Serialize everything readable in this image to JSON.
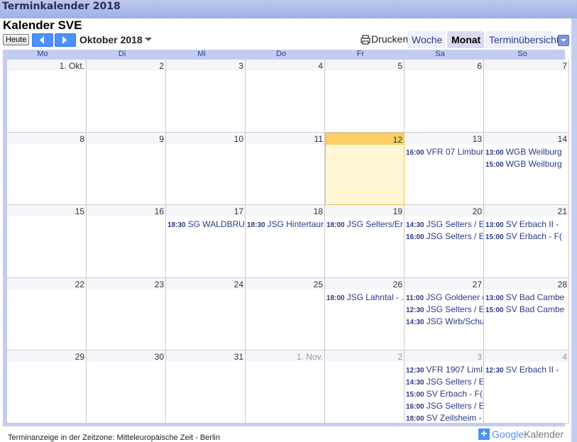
{
  "window": {
    "title": "Terminkalender 2018"
  },
  "calendar": {
    "title": "Kalender SVE"
  },
  "toolbar": {
    "today": "Heute",
    "month_label": "Oktober 2018",
    "print": "Drucken"
  },
  "tabs": {
    "week": "Woche",
    "month": "Monat",
    "agenda": "Terminübersicht"
  },
  "weekdays": [
    "Mo",
    "Di",
    "Mi",
    "Do",
    "Fr",
    "Sa",
    "So"
  ],
  "weeks": [
    [
      {
        "d": "1. Okt."
      },
      {
        "d": "2"
      },
      {
        "d": "3"
      },
      {
        "d": "4"
      },
      {
        "d": "5"
      },
      {
        "d": "6"
      },
      {
        "d": "7"
      }
    ],
    [
      {
        "d": "8"
      },
      {
        "d": "9"
      },
      {
        "d": "10"
      },
      {
        "d": "11"
      },
      {
        "d": "12",
        "today": true
      },
      {
        "d": "13"
      },
      {
        "d": "14"
      }
    ],
    [
      {
        "d": "15"
      },
      {
        "d": "16"
      },
      {
        "d": "17"
      },
      {
        "d": "18"
      },
      {
        "d": "19"
      },
      {
        "d": "20"
      },
      {
        "d": "21"
      }
    ],
    [
      {
        "d": "22"
      },
      {
        "d": "23"
      },
      {
        "d": "24"
      },
      {
        "d": "25"
      },
      {
        "d": "26"
      },
      {
        "d": "27"
      },
      {
        "d": "28"
      }
    ],
    [
      {
        "d": "29"
      },
      {
        "d": "30"
      },
      {
        "d": "31"
      },
      {
        "d": "1. Nov.",
        "other": true
      },
      {
        "d": "2",
        "other": true
      },
      {
        "d": "3",
        "other": true
      },
      {
        "d": "4",
        "other": true
      }
    ]
  ],
  "events": [
    {
      "week": 1,
      "day": 5,
      "items": [
        {
          "time": "16:00",
          "title": "VFR 07 Limbur"
        }
      ]
    },
    {
      "week": 1,
      "day": 6,
      "items": [
        {
          "time": "13:00",
          "title": "WGB Weilburg"
        },
        {
          "time": "15:00",
          "title": "WGB Weilburg"
        }
      ]
    },
    {
      "week": 2,
      "day": 2,
      "items": [
        {
          "time": "18:30",
          "title": "SG WALDBRUN"
        }
      ]
    },
    {
      "week": 2,
      "day": 3,
      "items": [
        {
          "time": "18:30",
          "title": "JSG Hintertaur"
        }
      ]
    },
    {
      "week": 2,
      "day": 4,
      "items": [
        {
          "time": "18:00",
          "title": "JSG Selters/Er"
        }
      ]
    },
    {
      "week": 2,
      "day": 5,
      "items": [
        {
          "time": "14:30",
          "title": "JSG Selters / E"
        },
        {
          "time": "16:00",
          "title": "JSG Selters / E"
        }
      ]
    },
    {
      "week": 2,
      "day": 6,
      "items": [
        {
          "time": "13:00",
          "title": "SV Erbach II -"
        },
        {
          "time": "15:00",
          "title": "SV Erbach - F("
        }
      ]
    },
    {
      "week": 3,
      "day": 4,
      "items": [
        {
          "time": "18:00",
          "title": "JSG Lahntal - ."
        }
      ]
    },
    {
      "week": 3,
      "day": 5,
      "items": [
        {
          "time": "11:00",
          "title": "JSG Goldener ("
        },
        {
          "time": "12:30",
          "title": "JSG Selters / E"
        },
        {
          "time": "14:30",
          "title": "JSG Wirb/Schu"
        }
      ]
    },
    {
      "week": 3,
      "day": 6,
      "items": [
        {
          "time": "13:00",
          "title": "SV Bad Cambe"
        },
        {
          "time": "15:00",
          "title": "SV Bad Cambe"
        }
      ]
    },
    {
      "week": 4,
      "day": 5,
      "items": [
        {
          "time": "12:30",
          "title": "VFR 1907 Liml"
        },
        {
          "time": "14:30",
          "title": "JSG Selters / E"
        },
        {
          "time": "15:00",
          "title": "SV Erbach - F("
        },
        {
          "time": "16:00",
          "title": "JSG Selters / E"
        },
        {
          "time": "18:00",
          "title": "SV Zeilsheim -"
        }
      ]
    },
    {
      "week": 4,
      "day": 6,
      "items": [
        {
          "time": "12:30",
          "title": "SV Erbach II -"
        }
      ]
    }
  ],
  "footer": {
    "timezone": "Terminanzeige in der Zeitzone: Mitteleuropäische Zeit - Berlin",
    "plus": "+",
    "g_google": "Google",
    "g_kalender": "Kalender"
  },
  "colors": {
    "accent": "#4d90fe",
    "event_text": "#2b3a8a",
    "today_bg": "#fff6d6",
    "today_header": "#fbcf62",
    "frame": "#c3cdf2"
  }
}
